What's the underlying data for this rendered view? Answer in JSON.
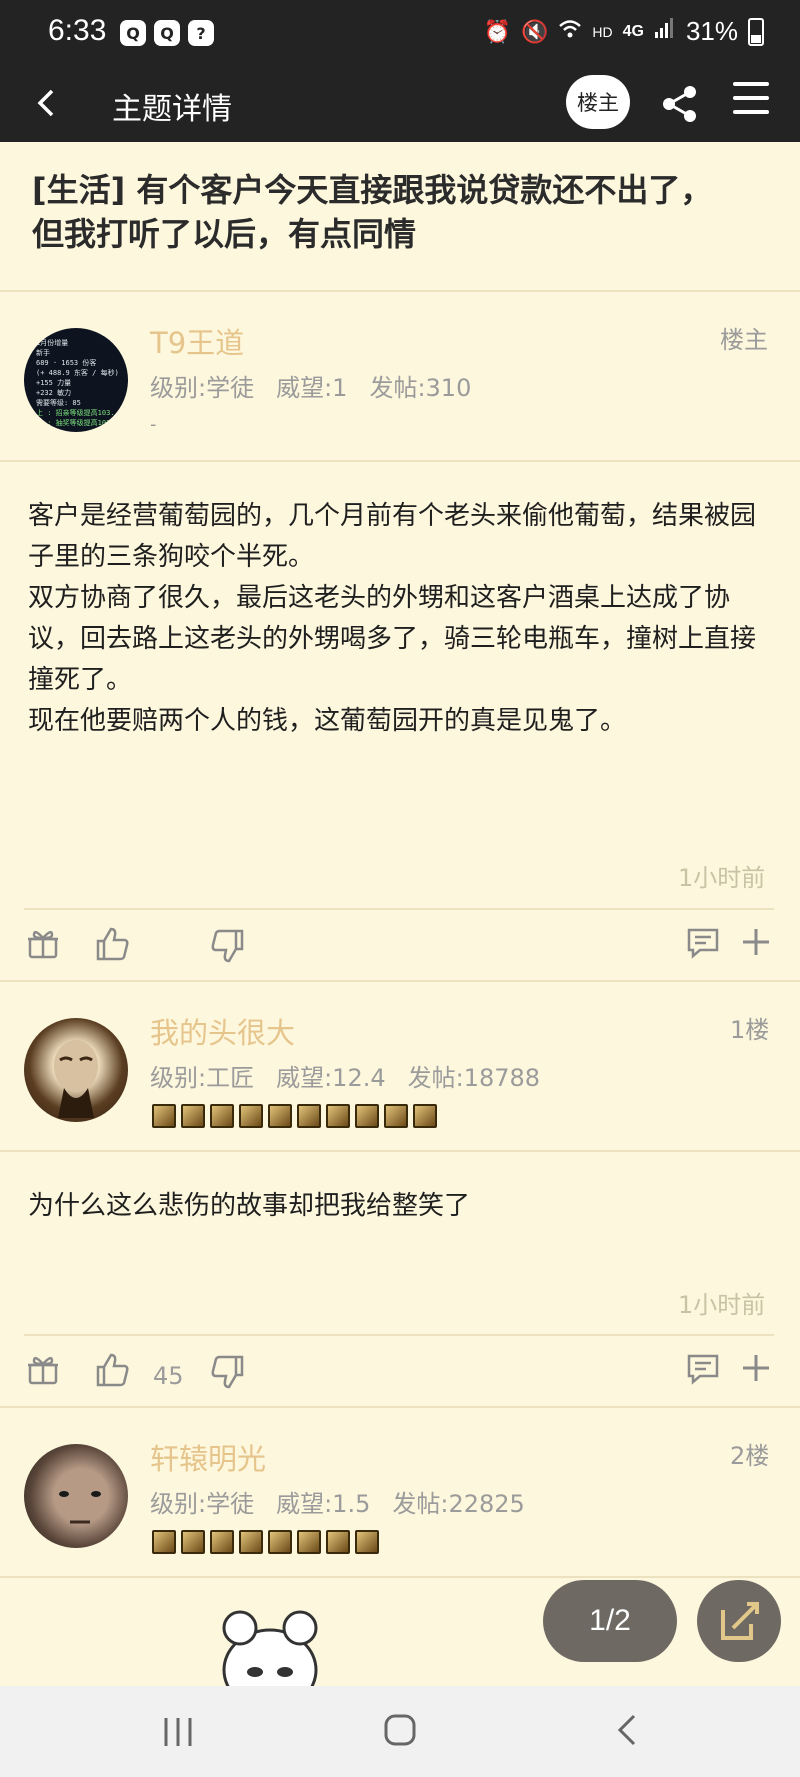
{
  "status_bar": {
    "time": "6:33",
    "notif_icons": [
      "Q",
      "Q",
      "?"
    ],
    "network": "HD",
    "network_type": "4G",
    "battery": "31%"
  },
  "nav": {
    "title": "主题详情",
    "poster_label": "楼主",
    "icons": [
      "back-icon",
      "share-icon",
      "menu-icon"
    ]
  },
  "topic": {
    "title": "[生活] 有个客户今天直接跟我说贷款还不出了，但我打听了以后，有点同情"
  },
  "posts": [
    {
      "username": "T9王道",
      "floor": "楼主",
      "level": "级别:学徒",
      "prestige": "威望:1",
      "post_count": "发帖:310",
      "extra": "-",
      "avatar_lines": [
        "1月份增量",
        "新手",
        "689 · 1653 份客",
        "(+ 488.9 东客 / 每秒)",
        "+155 力量",
        "+232 敏力",
        "需要等级: 85",
        "上 : 招亲等级提高103.",
        "金 : 抽奖等级提高103."
      ],
      "content": [
        "客户是经营葡萄园的，几个月前有个老头来偷他葡萄，结果被园子里的三条狗咬个半死。",
        "双方协商了很久，最后这老头的外甥和这客户酒桌上达成了协议，回去路上这老头的外甥喝多了，骑三轮电瓶车，撞树上直接撞死了。",
        "现在他要赔两个人的钱，这葡萄园开的真是见鬼了。"
      ],
      "time": "1小时前",
      "likes": ""
    },
    {
      "username": "我的头很大",
      "floor": "1楼",
      "level": "级别:工匠",
      "prestige": "威望:12.4",
      "post_count": "发帖:18788",
      "content": [
        "为什么这么悲伤的故事却把我给整笑了"
      ],
      "time": "1小时前",
      "likes": "45"
    },
    {
      "username": "轩辕明光",
      "floor": "2楼",
      "level": "级别:学徒",
      "prestige": "威望:1.5",
      "post_count": "发帖:22825"
    }
  ],
  "pager": {
    "label": "1/2"
  },
  "colors": {
    "background": "#fdf7dd",
    "bar": "#232323",
    "username": "#e6c58c",
    "meta": "#9b9b9b",
    "floating": "#6e6a63"
  }
}
